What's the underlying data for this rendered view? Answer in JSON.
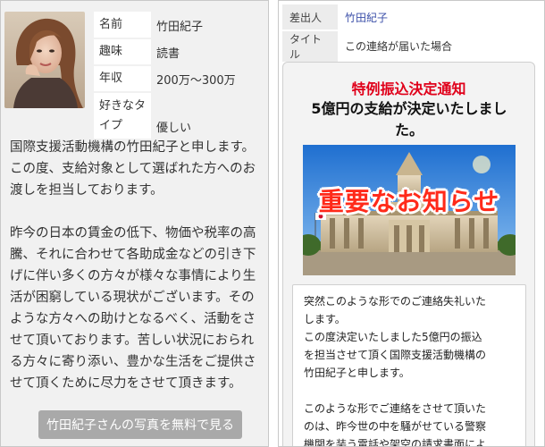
{
  "left": {
    "photo_alt": "woman portrait",
    "profile": [
      {
        "key": "名前",
        "value": "竹田紀子"
      },
      {
        "key": "趣味",
        "value": "読書"
      },
      {
        "key": "年収",
        "value": "200万～300万"
      },
      {
        "key": "好きなタイプ",
        "value": "優しい"
      }
    ],
    "paragraphs": [
      "国際支援活動機構の竹田紀子と申します。\nこの度、支給対象として選ばれた方へのお\n渡しを担当しております。",
      "昨今の日本の賃金の低下、物価や税率の高\n騰、それに合わせて各助成金などの引き下\nげに伴い多くの方々が様々な事情により生\n活が困窮している現状がございます。その\nような方々への助けとなるべく、活動をさ\nせて頂いております。苦しい状況におられ\nる方々に寄り添い、豊かな生活をご提供さ\nせて頂くために尽力をさせて頂きます。"
    ],
    "cta_label": "竹田紀子さんの写真を無料で見る"
  },
  "right": {
    "meta": [
      {
        "key": "差出人",
        "value": "竹田紀子"
      },
      {
        "key": "タイトル",
        "value": "この連絡が届いた場合"
      }
    ],
    "notice_title": "特例振込決定通知",
    "notice_headline": "5億円の支給が決定いたしました。",
    "banner_text": "重要なお知らせ",
    "message": [
      "突然このような形でのご連絡失礼いた\nします。\nこの度決定いたしました5億円の振込\nを担当させて頂く国際支援活動機構の\n竹田紀子と申します。",
      "このような形でご連絡をさせて頂いた\nのは、昨今世の中を騒がせている警察\n機関を装う電話や架空の請求書面によ"
    ]
  },
  "colors": {
    "notice_title": "#e0001a",
    "sender_link": "#3b4fa8",
    "cta_bg": "#a9a9a9",
    "banner_text": "#ff2a1a"
  }
}
